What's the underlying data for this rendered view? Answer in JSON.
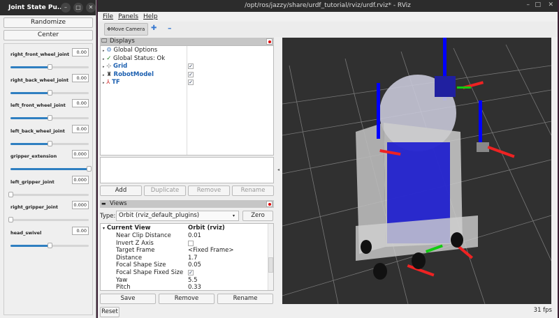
{
  "joint_window": {
    "title": "Joint State Pu...",
    "randomize": "Randomize",
    "center": "Center",
    "joints": [
      {
        "name": "right_front_wheel_joint",
        "value": "0.00",
        "position": 0.5
      },
      {
        "name": "right_back_wheel_joint",
        "value": "0.00",
        "position": 0.5
      },
      {
        "name": "left_front_wheel_joint",
        "value": "0.00",
        "position": 0.5
      },
      {
        "name": "left_back_wheel_joint",
        "value": "0.00",
        "position": 0.5
      },
      {
        "name": "gripper_extension",
        "value": "0.000",
        "position": 1.0
      },
      {
        "name": "left_gripper_joint",
        "value": "0.000",
        "position": 0.0
      },
      {
        "name": "right_gripper_joint",
        "value": "0.000",
        "position": 0.0
      },
      {
        "name": "head_swivel",
        "value": "0.00",
        "position": 0.5
      }
    ]
  },
  "rviz": {
    "title": "/opt/ros/jazzy/share/urdf_tutorial/rviz/urdf.rviz* - RViz",
    "menu": [
      "File",
      "Panels",
      "Help"
    ],
    "toolbar": {
      "move_camera": "Move Camera"
    },
    "displays": {
      "title": "Displays",
      "items": [
        {
          "label": "Global Options",
          "icon": "gear-icon",
          "checked": null
        },
        {
          "label": "Global Status: Ok",
          "icon": "check-icon",
          "checked": null
        },
        {
          "label": "Grid",
          "icon": "grid-icon",
          "checked": true
        },
        {
          "label": "RobotModel",
          "icon": "robot-icon",
          "checked": true
        },
        {
          "label": "TF",
          "icon": "axes-icon",
          "checked": true
        }
      ],
      "buttons": [
        "Add",
        "Duplicate",
        "Remove",
        "Rename"
      ]
    },
    "views": {
      "title": "Views",
      "type_label": "Type:",
      "type_value": "Orbit (rviz_default_plugins)",
      "zero": "Zero",
      "current_view": "Current View",
      "current_view_value": "Orbit (rviz)",
      "props": [
        {
          "k": "Near Clip Distance",
          "v": "0.01"
        },
        {
          "k": "Invert Z Axis",
          "v": "",
          "check": false
        },
        {
          "k": "Target Frame",
          "v": "<Fixed Frame>"
        },
        {
          "k": "Distance",
          "v": "1.7"
        },
        {
          "k": "Focal Shape Size",
          "v": "0.05"
        },
        {
          "k": "Focal Shape Fixed Size",
          "v": "",
          "check": true
        },
        {
          "k": "Yaw",
          "v": "5.5"
        },
        {
          "k": "Pitch",
          "v": "0.33"
        }
      ],
      "buttons": [
        "Save",
        "Remove",
        "Rename"
      ]
    },
    "reset": "Reset",
    "fps": "31 fps"
  }
}
